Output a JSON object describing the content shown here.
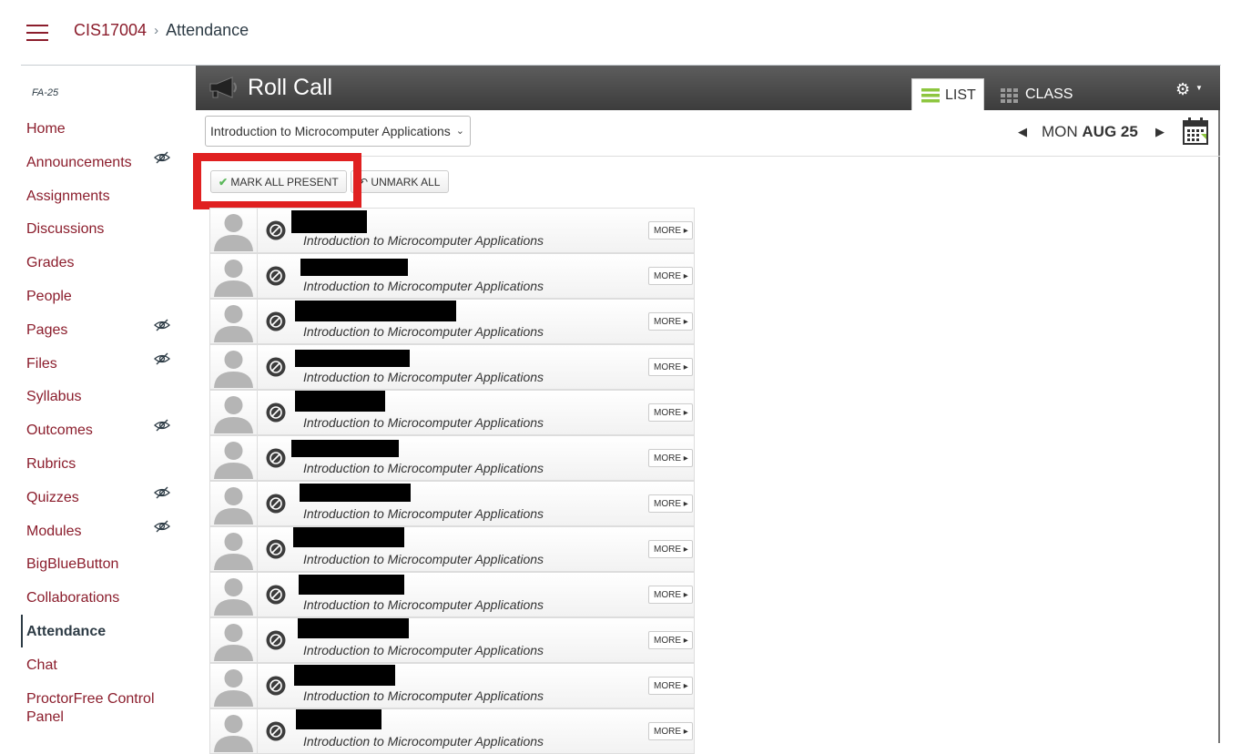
{
  "breadcrumb": {
    "course": "CIS17004",
    "separator": "›",
    "current": "Attendance"
  },
  "sidebar": {
    "term": "FA-25",
    "items": [
      {
        "label": "Home",
        "hidden": false
      },
      {
        "label": "Announcements",
        "hidden": true
      },
      {
        "label": "Assignments",
        "hidden": false
      },
      {
        "label": "Discussions",
        "hidden": false
      },
      {
        "label": "Grades",
        "hidden": false
      },
      {
        "label": "People",
        "hidden": false
      },
      {
        "label": "Pages",
        "hidden": true
      },
      {
        "label": "Files",
        "hidden": true
      },
      {
        "label": "Syllabus",
        "hidden": false
      },
      {
        "label": "Outcomes",
        "hidden": true
      },
      {
        "label": "Rubrics",
        "hidden": false
      },
      {
        "label": "Quizzes",
        "hidden": true
      },
      {
        "label": "Modules",
        "hidden": true
      },
      {
        "label": "BigBlueButton",
        "hidden": false
      },
      {
        "label": "Collaborations",
        "hidden": false
      },
      {
        "label": "Attendance",
        "hidden": false,
        "active": true
      },
      {
        "label": "Chat",
        "hidden": false
      },
      {
        "label": "ProctorFree Control Panel",
        "hidden": false
      }
    ]
  },
  "rollcall": {
    "title": "Roll Call",
    "tabs": {
      "list": "LIST",
      "class": "CLASS"
    },
    "course_select": "Introduction to Microcomputer Applications",
    "date": {
      "day": "MON",
      "monthday": "AUG 25"
    },
    "buttons": {
      "mark_all": "MARK ALL PRESENT",
      "unmark_all": "UNMARK ALL"
    },
    "more_label": "MORE ▸",
    "students": [
      {
        "course": "Introduction to Microcomputer Applications"
      },
      {
        "course": "Introduction to Microcomputer Applications"
      },
      {
        "course": "Introduction to Microcomputer Applications"
      },
      {
        "course": "Introduction to Microcomputer Applications"
      },
      {
        "course": "Introduction to Microcomputer Applications"
      },
      {
        "course": "Introduction to Microcomputer Applications"
      },
      {
        "course": "Introduction to Microcomputer Applications"
      },
      {
        "course": "Introduction to Microcomputer Applications"
      },
      {
        "course": "Introduction to Microcomputer Applications"
      },
      {
        "course": "Introduction to Microcomputer Applications"
      },
      {
        "course": "Introduction to Microcomputer Applications"
      },
      {
        "course": "Introduction to Microcomputer Applications"
      }
    ]
  },
  "colors": {
    "brand": "#8b1d2c",
    "header_bg": "#4a4a4a",
    "highlight": "#e02020",
    "list_icon": "#8dc63f"
  },
  "icons": {
    "menu": "hamburger-icon",
    "hidden": "eye-slash-icon",
    "megaphone": "megaphone-icon",
    "settings": "gear-icon",
    "calendar": "calendar-icon",
    "status": "unmarked-status-icon"
  }
}
